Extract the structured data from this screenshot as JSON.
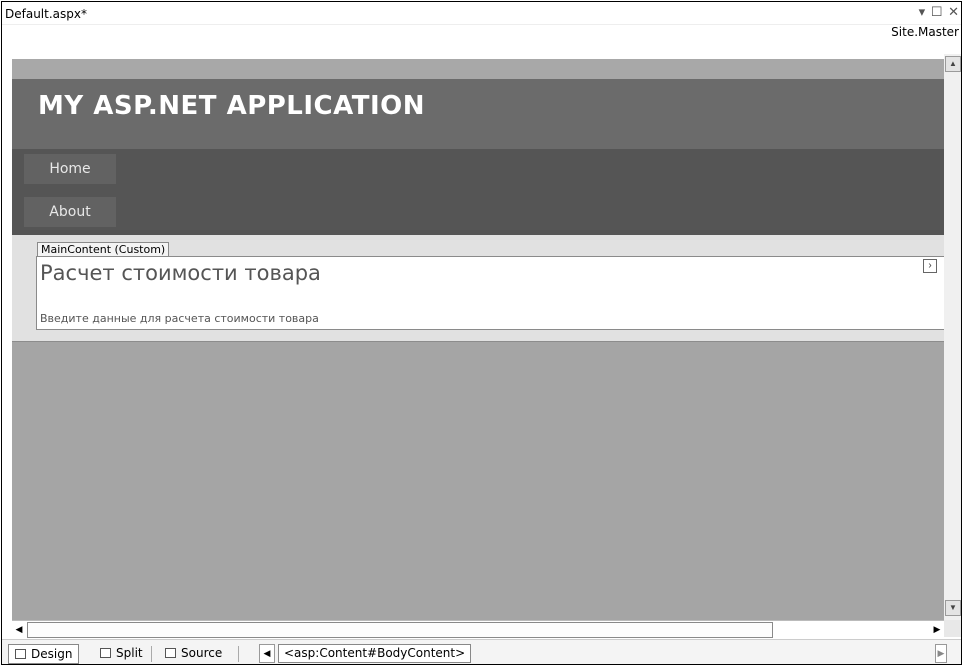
{
  "tab": {
    "title": "Default.aspx*",
    "dropdown_icon": "chevron-down-icon",
    "maximize_icon": "maximize-icon",
    "close_icon": "close-icon"
  },
  "master_label": "Site.Master",
  "site": {
    "title": "MY ASP.NET APPLICATION",
    "menu": [
      {
        "label": "Home"
      },
      {
        "label": "About"
      }
    ]
  },
  "content": {
    "region_tag": "MainContent (Custom)",
    "heading": "Расчет стоимости товара",
    "text": "Введите данные для расчета стоимости товара"
  },
  "bottom": {
    "design_label": "Design",
    "split_label": "Split",
    "source_label": "Source",
    "breadcrumb": "<asp:Content#BodyContent>"
  },
  "colors": {
    "header_bg": "#6b6b6b",
    "menu_bg": "#555555",
    "surface_bg": "#a5a5a5"
  }
}
